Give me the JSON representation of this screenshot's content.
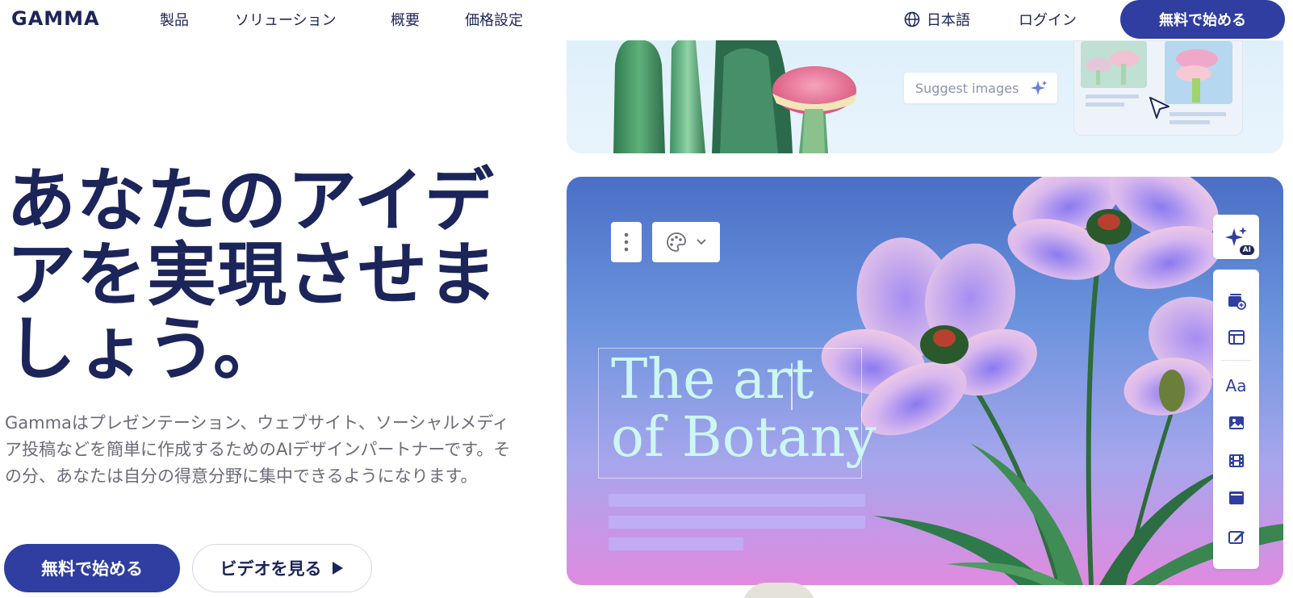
{
  "header": {
    "logo": "GAMMA",
    "nav": [
      "製品",
      "ソリューション",
      "概要",
      "価格設定"
    ],
    "language": "日本語",
    "login": "ログイン",
    "cta": "無料で始める"
  },
  "hero": {
    "headline": "あなたのアイデアを実現させましょう。",
    "description": "Gammaはプレゼンテーション、ウェブサイト、ソーシャルメディア投稿などを簡単に作成するためのAIデザインパートナーです。その分、あなたは自分の得意分野に集中できるようになります。",
    "primary_button": "無料で始める",
    "secondary_button": "ビデオを見る"
  },
  "preview_top": {
    "suggest_label": "Suggest images"
  },
  "preview_main": {
    "title_line1": "The art",
    "title_line2": "of Botany",
    "ai_tag": "AI",
    "text_style_label": "Aa"
  },
  "icons": [
    "globe-icon",
    "sparkle-icon",
    "cursor-icon",
    "more-vertical-icon",
    "palette-icon",
    "chevron-down-icon",
    "ai-sparkle-icon",
    "add-card-icon",
    "layout-icon",
    "image-icon",
    "video-icon",
    "embed-icon",
    "edit-icon",
    "play-icon"
  ],
  "colors": {
    "brand": "#2f3ea0",
    "text": "#1c2559",
    "muted": "#6b6b7a",
    "card_title": "#ccf7f3"
  }
}
